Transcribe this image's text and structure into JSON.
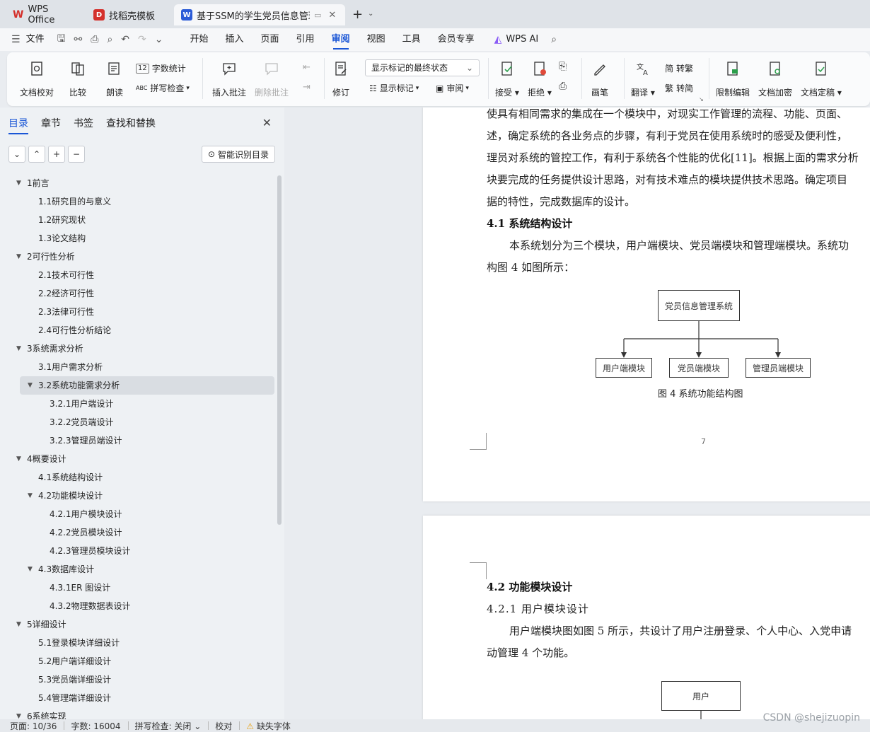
{
  "tabs": [
    {
      "label": "WPS Office",
      "color": "#d4302b"
    },
    {
      "label": "找稻壳模板",
      "color": "#d4302b"
    },
    {
      "label": "基于SSM的学生党员信息管理",
      "color": "#2b5bd7",
      "active": true
    }
  ],
  "menu": {
    "file": "文件",
    "items": [
      "开始",
      "插入",
      "页面",
      "引用",
      "审阅",
      "视图",
      "工具",
      "会员专享"
    ],
    "active": "审阅",
    "wps_ai": "WPS AI"
  },
  "ribbon": {
    "doc_check": "文档校对",
    "compare": "比较",
    "read": "朗读",
    "word_count": "字数统计",
    "spell_check": "拼写检查",
    "insert_comment": "插入批注",
    "delete_comment": "删除批注",
    "revise": "修订",
    "markup_state": "显示标记的最终状态",
    "show_markup": "显示标记",
    "review": "审阅",
    "accept": "接受",
    "reject": "拒绝",
    "pen": "画笔",
    "translate": "翻译",
    "to_traditional": "转繁",
    "to_simplified": "转简",
    "restrict": "限制编辑",
    "encrypt": "文档加密",
    "finalize": "文档定稿"
  },
  "nav": {
    "tabs": [
      "目录",
      "章节",
      "书签",
      "查找和替换"
    ],
    "smart_toc": "智能识别目录",
    "toc": [
      {
        "label": "1前言",
        "level": 1,
        "expanded": true
      },
      {
        "label": "1.1研究目的与意义",
        "level": 2
      },
      {
        "label": "1.2研究现状",
        "level": 2
      },
      {
        "label": "1.3论文结构",
        "level": 2
      },
      {
        "label": "2可行性分析",
        "level": 1,
        "expanded": true
      },
      {
        "label": "2.1技术可行性",
        "level": 2
      },
      {
        "label": "2.2经济可行性",
        "level": 2
      },
      {
        "label": "2.3法律可行性",
        "level": 2
      },
      {
        "label": "2.4可行性分析结论",
        "level": 2
      },
      {
        "label": "3系统需求分析",
        "level": 1,
        "expanded": true
      },
      {
        "label": "3.1用户需求分析",
        "level": 2
      },
      {
        "label": "3.2系统功能需求分析",
        "level": 2,
        "expanded": true,
        "selected": true
      },
      {
        "label": "3.2.1用户端设计",
        "level": 3
      },
      {
        "label": "3.2.2党员端设计",
        "level": 3
      },
      {
        "label": "3.2.3管理员端设计",
        "level": 3
      },
      {
        "label": "4概要设计",
        "level": 1,
        "expanded": true
      },
      {
        "label": "4.1系统结构设计",
        "level": 2
      },
      {
        "label": "4.2功能模块设计",
        "level": 2,
        "expanded": true
      },
      {
        "label": "4.2.1用户模块设计",
        "level": 3
      },
      {
        "label": "4.2.2党员模块设计",
        "level": 3
      },
      {
        "label": "4.2.3管理员模块设计",
        "level": 3
      },
      {
        "label": "4.3数据库设计",
        "level": 2,
        "expanded": true
      },
      {
        "label": "4.3.1ER 图设计",
        "level": 3
      },
      {
        "label": "4.3.2物理数据表设计",
        "level": 3
      },
      {
        "label": "5详细设计",
        "level": 1,
        "expanded": true
      },
      {
        "label": "5.1登录模块详细设计",
        "level": 2
      },
      {
        "label": "5.2用户端详细设计",
        "level": 2
      },
      {
        "label": "5.3党员端详细设计",
        "level": 2
      },
      {
        "label": "5.4管理端详细设计",
        "level": 2
      },
      {
        "label": "6系统实现",
        "level": 1,
        "expanded": true
      }
    ]
  },
  "doc": {
    "p1_lines": [
      "使具有相同需求的集成在一个模块中，对现实工作管理的流程、功能、页面、",
      "述，确定系统的各业务点的步骤，有利于党员在使用系统时的感受及便利性，",
      "理员对系统的管控工作，有利于系统各个性能的优化[11]。根据上面的需求分析",
      "块要完成的任务提供设计思路，对有技术难点的模块提供技术思路。确定项目",
      "据的特性，完成数据库的设计。"
    ],
    "h41": "4.1  系统结构设计",
    "p2_lines": [
      "本系统划分为三个模块，用户端模块、党员端模块和管理端模块。系统功",
      "构图 4 如图所示："
    ],
    "diagram1": {
      "root": "党员信息管理系统",
      "children": [
        "用户端模块",
        "党员端模块",
        "管理员端模块"
      ]
    },
    "fig4_caption": "图 4  系统功能结构图",
    "page_number": "7",
    "h42": "4.2  功能模块设计",
    "h421": "4.2.1  用户模块设计",
    "p3_lines": [
      "用户端模块图如图 5 所示，共设计了用户注册登录、个人中心、入党申请",
      "动管理 4 个功能。"
    ],
    "diagram2_root": "用户"
  },
  "status": {
    "page": "页面: 10/36",
    "words": "字数: 16004",
    "spell": "拼写检查: 关闭",
    "proof": "校对",
    "missing_font": "缺失字体"
  },
  "watermark": "CSDN @shejizuopin"
}
